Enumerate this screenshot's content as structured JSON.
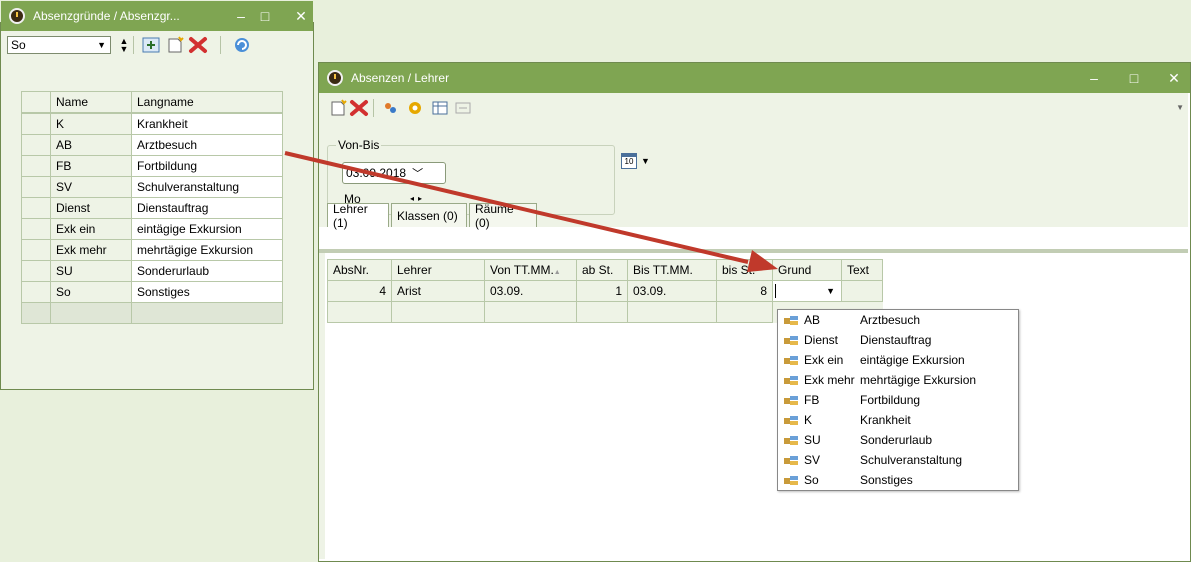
{
  "left_window": {
    "title": "Absenzgründe / Absenzgr...",
    "filter_value": "So",
    "columns": [
      "Name",
      "Langname"
    ],
    "rows": [
      {
        "name": "K",
        "langname": "Krankheit"
      },
      {
        "name": "AB",
        "langname": "Arztbesuch"
      },
      {
        "name": "FB",
        "langname": "Fortbildung"
      },
      {
        "name": "SV",
        "langname": "Schulveranstaltung"
      },
      {
        "name": "Dienst",
        "langname": "Dienstauftrag"
      },
      {
        "name": "Exk ein",
        "langname": "eintägige Exkursion"
      },
      {
        "name": "Exk mehr",
        "langname": "mehrtägige Exkursion"
      },
      {
        "name": "SU",
        "langname": "Sonderurlaub"
      },
      {
        "name": "So",
        "langname": "Sonstiges"
      }
    ]
  },
  "right_window": {
    "title": "Absenzen / Lehrer",
    "group_label": "Von-Bis",
    "date_value": "03.09.2018",
    "weekday": "Mo",
    "calendar_day": "10",
    "tabs": [
      "Lehrer (1)",
      "Klassen (0)",
      "Räume (0)"
    ],
    "columns": [
      "AbsNr.",
      "Lehrer",
      "Von TT.MM.",
      "ab St.",
      "Bis TT.MM.",
      "bis St.",
      "Grund",
      "Text"
    ],
    "row": {
      "absnr": "4",
      "lehrer": "Arist",
      "von": "03.09.",
      "ab": "1",
      "bis": "03.09.",
      "bisst": "8",
      "grund": "",
      "text": ""
    },
    "dropdown": [
      {
        "code": "AB",
        "name": "Arztbesuch"
      },
      {
        "code": "Dienst",
        "name": "Dienstauftrag"
      },
      {
        "code": "Exk ein",
        "name": "eintägige Exkursion"
      },
      {
        "code": "Exk mehr",
        "name": "mehrtägige Exkursion"
      },
      {
        "code": "FB",
        "name": "Fortbildung"
      },
      {
        "code": "K",
        "name": "Krankheit"
      },
      {
        "code": "SU",
        "name": "Sonderurlaub"
      },
      {
        "code": "SV",
        "name": "Schulveranstaltung"
      },
      {
        "code": "So",
        "name": "Sonstiges"
      }
    ]
  },
  "colors": {
    "titlebar": "#7fa552",
    "arrow": "#c0392b",
    "background": "#e8f0dc"
  },
  "icons": {
    "app": "clock-icon",
    "new": "new-doc-icon",
    "delete": "delete-x-icon",
    "refresh": "refresh-icon",
    "calendar": "calendar-icon"
  }
}
